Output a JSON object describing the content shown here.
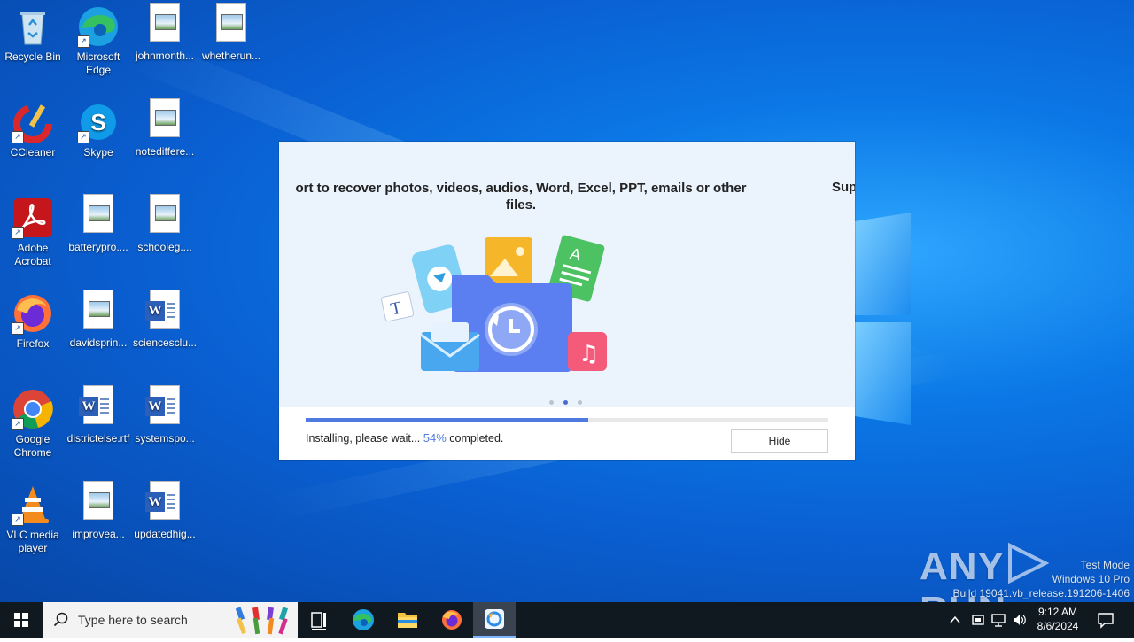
{
  "desktop": {
    "icons": [
      {
        "label": "Recycle Bin"
      },
      {
        "label": "Microsoft Edge"
      },
      {
        "label": "johnmonth..."
      },
      {
        "label": "whetherun..."
      },
      {
        "label": "CCleaner"
      },
      {
        "label": "Skype"
      },
      {
        "label": "notediffere..."
      },
      {
        "label": "Adobe Acrobat"
      },
      {
        "label": "batterypro...."
      },
      {
        "label": "schooleg...."
      },
      {
        "label": "Firefox"
      },
      {
        "label": "davidsprin..."
      },
      {
        "label": "sciencesclu..."
      },
      {
        "label": "Google Chrome"
      },
      {
        "label": "districtelse.rtf"
      },
      {
        "label": "systemspo..."
      },
      {
        "label": "VLC media player"
      },
      {
        "label": "improvea..."
      },
      {
        "label": "updatedhig..."
      }
    ]
  },
  "installer": {
    "slide_text": "ort to recover photos, videos, audios, Word, Excel, PPT, emails or other files.",
    "slide_text_next": "Sup",
    "progress": 0.54,
    "status_prefix": "Installing, please wait...",
    "status_percent": "54%",
    "status_suffix": "completed.",
    "hide_label": "Hide",
    "active_dot": 1,
    "dot_count": 3,
    "accent": "#4f7be0"
  },
  "watermark": {
    "logo_left": "ANY",
    "logo_right": "RUN",
    "line1": "Test Mode",
    "line2": "Windows 10 Pro",
    "line3": "Build 19041.vb_release.191206-1406"
  },
  "taskbar": {
    "search_placeholder": "Type here to search",
    "time": "9:12 AM",
    "date": "8/6/2024"
  }
}
